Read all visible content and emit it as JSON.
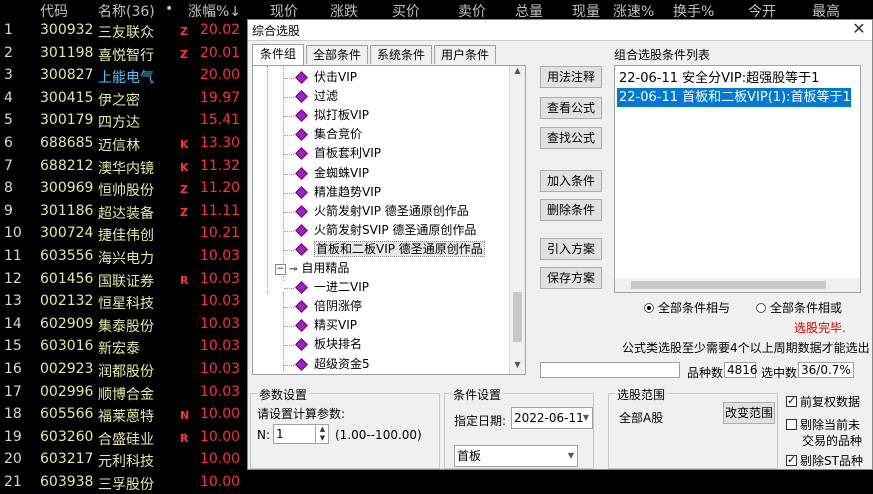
{
  "stock_header": {
    "code": "代码",
    "name": "名称(36)",
    "dot": "•",
    "pct": "涨幅%↓",
    "price": "现价",
    "change": "涨跌",
    "buy": "买价",
    "sell": "卖价",
    "volume": "总量",
    "cur_vol": "现量",
    "speed": "涨速%",
    "turnover": "换手%",
    "open": "今开",
    "high": "最高"
  },
  "stocks": [
    {
      "idx": "1",
      "code": "300932",
      "name": "三友联众",
      "flag": "Z",
      "pct": "20.02",
      "name_color": "#e8e8a0"
    },
    {
      "idx": "2",
      "code": "301198",
      "name": "喜悦智行",
      "flag": "Z",
      "pct": "20.01",
      "name_color": "#e8e8a0"
    },
    {
      "idx": "3",
      "code": "300827",
      "name": "上能电气",
      "flag": "",
      "pct": "20.00",
      "name_color": "#40c8ff"
    },
    {
      "idx": "4",
      "code": "300415",
      "name": "伊之密",
      "flag": "",
      "pct": "19.97",
      "name_color": "#e8e8a0"
    },
    {
      "idx": "5",
      "code": "300179",
      "name": "四方达",
      "flag": "",
      "pct": "15.41",
      "name_color": "#e8e8a0"
    },
    {
      "idx": "6",
      "code": "688685",
      "name": "迈信林",
      "flag": "K",
      "pct": "13.30",
      "name_color": "#e8e8a0"
    },
    {
      "idx": "7",
      "code": "688212",
      "name": "澳华内镜",
      "flag": "K",
      "pct": "11.32",
      "name_color": "#e8e8a0"
    },
    {
      "idx": "8",
      "code": "300969",
      "name": "恒帅股份",
      "flag": "Z",
      "pct": "11.20",
      "name_color": "#e8e8a0"
    },
    {
      "idx": "9",
      "code": "301186",
      "name": "超达装备",
      "flag": "Z",
      "pct": "11.11",
      "name_color": "#e8e8a0"
    },
    {
      "idx": "10",
      "code": "300724",
      "name": "捷佳伟创",
      "flag": "",
      "pct": "10.21",
      "name_color": "#e8e8a0"
    },
    {
      "idx": "11",
      "code": "603556",
      "name": "海兴电力",
      "flag": "",
      "pct": "10.03",
      "name_color": "#e8e8a0"
    },
    {
      "idx": "12",
      "code": "601456",
      "name": "国联证券",
      "flag": "R",
      "pct": "10.03",
      "name_color": "#e8e8a0"
    },
    {
      "idx": "13",
      "code": "002132",
      "name": "恒星科技",
      "flag": "",
      "pct": "10.03",
      "name_color": "#e8e8a0"
    },
    {
      "idx": "14",
      "code": "602909",
      "name": "集泰股份",
      "flag": "",
      "pct": "10.03",
      "name_color": "#e8e8a0"
    },
    {
      "idx": "15",
      "code": "603016",
      "name": "新宏泰",
      "flag": "",
      "pct": "10.03",
      "name_color": "#e8e8a0"
    },
    {
      "idx": "16",
      "code": "002923",
      "name": "润都股份",
      "flag": "",
      "pct": "10.03",
      "name_color": "#e8e8a0"
    },
    {
      "idx": "17",
      "code": "002996",
      "name": "顺博合金",
      "flag": "",
      "pct": "10.03",
      "name_color": "#e8e8a0"
    },
    {
      "idx": "18",
      "code": "605566",
      "name": "福莱蒽特",
      "flag": "N",
      "pct": "10.00",
      "name_color": "#e8e8a0"
    },
    {
      "idx": "19",
      "code": "603260",
      "name": "合盛硅业",
      "flag": "R",
      "pct": "10.00",
      "name_color": "#e8e8a0"
    },
    {
      "idx": "20",
      "code": "603217",
      "name": "元利科技",
      "flag": "",
      "pct": "10.00",
      "name_color": "#e8e8a0"
    },
    {
      "idx": "21",
      "code": "603938",
      "name": "三孚股份",
      "flag": "",
      "pct": "10.00",
      "name_color": "#e8e8a0"
    }
  ],
  "dialog": {
    "title": "综合选股",
    "close": "✕",
    "tabs": [
      "条件组",
      "全部条件",
      "系统条件",
      "用户条件"
    ],
    "tree_items": [
      "伏击VIP",
      "过滤",
      "拟打板VIP",
      "集合竞价",
      "首板套利VIP",
      "金蜘蛛VIP",
      "精准趋势VIP",
      "火箭发射VIP 德圣通原创作品",
      "火箭发射SVIP 德圣通原创作品",
      "首板和二板VIP 德圣通原创作品"
    ],
    "tree_group": "自用精品",
    "tree_group_items": [
      "一进二VIP",
      "倍阴涨停",
      "精买VIP",
      "板块排名",
      "超级资金5"
    ],
    "buttons": {
      "usage": "用法注释",
      "view": "查看公式",
      "find": "查找公式",
      "add": "加入条件",
      "delete": "删除条件",
      "load": "引入方案",
      "save": "保存方案"
    },
    "cond_list_label": "组合选股条件列表",
    "cond_items": [
      "22-06-11 安全分VIP:超强股等于1",
      "22-06-11 首板和二板VIP(1):首板等于1"
    ],
    "radio_and": "全部条件相与",
    "radio_or": "全部条件相或",
    "status": "选股完毕.",
    "note": "公式类选股至少需要4个以上周期数据才能选出",
    "count_label": "品种数",
    "count_value": "4816",
    "selected_label": "选中数",
    "selected_value": "36/0.7%",
    "params": {
      "title": "参数设置",
      "prompt": "请设置计算参数:",
      "n_label": "N:",
      "n_value": "1",
      "range": "(1.00--100.00)"
    },
    "condition": {
      "title": "条件设置",
      "date_label": "指定日期:",
      "date_value": "2022-06-11",
      "select_value": "首板"
    },
    "scope": {
      "title": "选股范围",
      "value": "全部A股",
      "change_btn": "改变范围"
    },
    "checks": {
      "adjust": "前复权数据",
      "exclude_suspend_1": "剔除当前未",
      "exclude_suspend_2": "交易的品种",
      "exclude_st": "剔除ST品种"
    }
  }
}
